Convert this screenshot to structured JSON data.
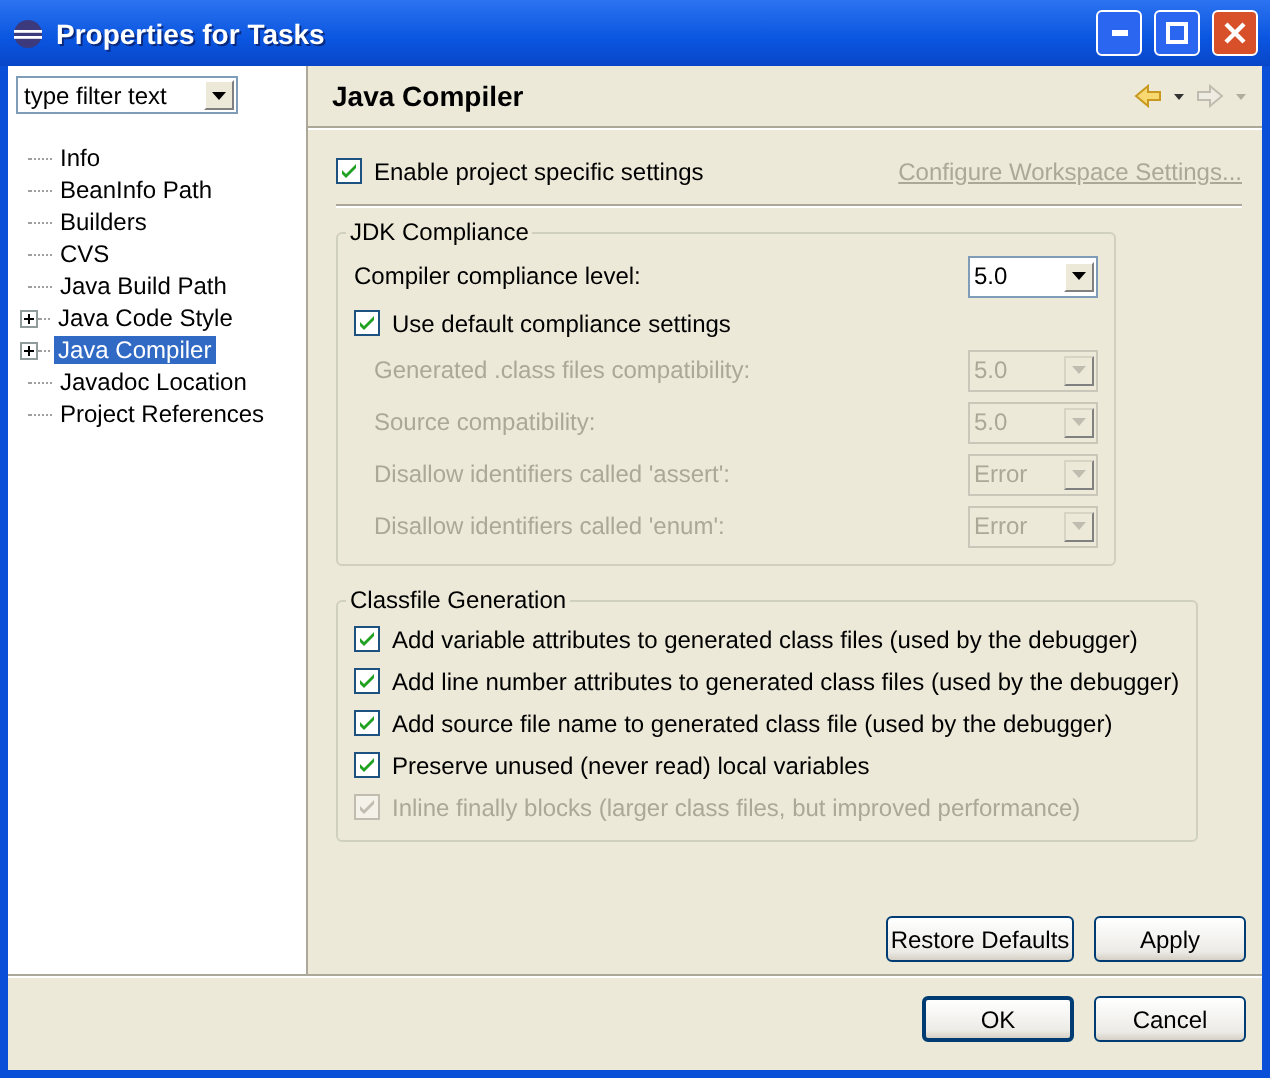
{
  "window": {
    "title": "Properties for Tasks"
  },
  "filter": {
    "placeholder": "type filter text"
  },
  "tree": [
    {
      "label": "Info",
      "kind": "leaf",
      "selected": false
    },
    {
      "label": "BeanInfo Path",
      "kind": "leaf",
      "selected": false
    },
    {
      "label": "Builders",
      "kind": "leaf",
      "selected": false
    },
    {
      "label": "CVS",
      "kind": "leaf",
      "selected": false
    },
    {
      "label": "Java Build Path",
      "kind": "leaf",
      "selected": false
    },
    {
      "label": "Java Code Style",
      "kind": "group",
      "selected": false
    },
    {
      "label": "Java Compiler",
      "kind": "group",
      "selected": true
    },
    {
      "label": "Javadoc Location",
      "kind": "leaf",
      "selected": false
    },
    {
      "label": "Project References",
      "kind": "leaf",
      "selected": false
    }
  ],
  "page": {
    "title": "Java Compiler",
    "enable": {
      "label": "Enable project specific settings",
      "checked": true
    },
    "configure_link": "Configure Workspace Settings...",
    "jdk": {
      "title": "JDK Compliance",
      "level": {
        "label": "Compiler compliance level:",
        "value": "5.0"
      },
      "use_default": {
        "label": "Use default compliance settings",
        "checked": true
      },
      "rows": [
        {
          "label": "Generated .class files compatibility:",
          "value": "5.0",
          "disabled": true
        },
        {
          "label": "Source compatibility:",
          "value": "5.0",
          "disabled": true
        },
        {
          "label": "Disallow identifiers called 'assert':",
          "value": "Error",
          "disabled": true
        },
        {
          "label": "Disallow identifiers called 'enum':",
          "value": "Error",
          "disabled": true
        }
      ]
    },
    "classfile": {
      "title": "Classfile Generation",
      "options": [
        {
          "label": "Add variable attributes to generated class files (used by the debugger)",
          "checked": true,
          "disabled": false
        },
        {
          "label": "Add line number attributes to generated class files (used by the debugger)",
          "checked": true,
          "disabled": false
        },
        {
          "label": "Add source file name to generated class file (used by the debugger)",
          "checked": true,
          "disabled": false
        },
        {
          "label": "Preserve unused (never read) local variables",
          "checked": true,
          "disabled": false
        },
        {
          "label": "Inline finally blocks (larger class files, but improved performance)",
          "checked": true,
          "disabled": true
        }
      ]
    },
    "buttons": [
      "Restore Defaults",
      "Apply"
    ]
  },
  "dialog_buttons": [
    "OK",
    "Cancel"
  ]
}
